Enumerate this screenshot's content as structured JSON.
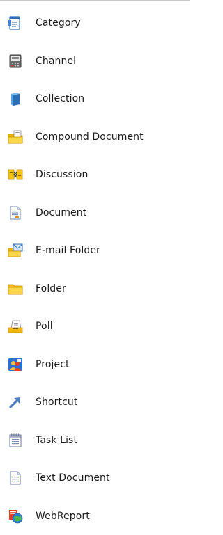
{
  "menu": {
    "items": [
      {
        "label": "Category",
        "icon": "category-icon"
      },
      {
        "label": "Channel",
        "icon": "channel-icon"
      },
      {
        "label": "Collection",
        "icon": "collection-icon"
      },
      {
        "label": "Compound Document",
        "icon": "compound-document-icon"
      },
      {
        "label": "Discussion",
        "icon": "discussion-icon"
      },
      {
        "label": "Document",
        "icon": "document-icon"
      },
      {
        "label": "E-mail Folder",
        "icon": "email-folder-icon"
      },
      {
        "label": "Folder",
        "icon": "folder-icon"
      },
      {
        "label": "Poll",
        "icon": "poll-icon"
      },
      {
        "label": "Project",
        "icon": "project-icon"
      },
      {
        "label": "Shortcut",
        "icon": "shortcut-icon"
      },
      {
        "label": "Task List",
        "icon": "task-list-icon"
      },
      {
        "label": "Text Document",
        "icon": "text-document-icon"
      },
      {
        "label": "WebReport",
        "icon": "webreport-icon"
      }
    ]
  }
}
